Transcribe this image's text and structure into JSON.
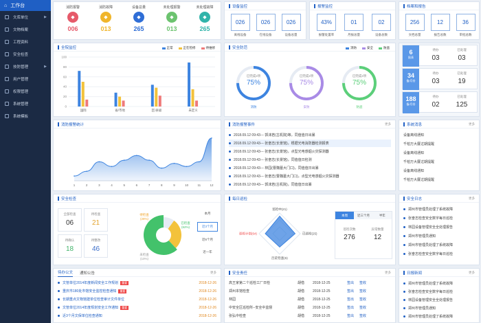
{
  "sidebar": {
    "head": "工作台",
    "items": [
      {
        "label": "文库单位",
        "arrow": true
      },
      {
        "label": "文物档案",
        "arrow": false
      },
      {
        "label": "工程资料",
        "arrow": false
      },
      {
        "label": "安全检查",
        "arrow": false
      },
      {
        "label": "技防管理",
        "arrow": true
      },
      {
        "label": "用户管理",
        "arrow": false
      },
      {
        "label": "权限管理",
        "arrow": false
      },
      {
        "label": "系统管理",
        "arrow": false
      },
      {
        "label": "系统模板",
        "arrow": false
      }
    ]
  },
  "stats": [
    {
      "label": "消防报警",
      "value": "006",
      "color": "#e65a6a"
    },
    {
      "label": "消防故障",
      "value": "013",
      "color": "#f0b52b"
    },
    {
      "label": "设备总量",
      "value": "265",
      "color": "#2f6ed6"
    },
    {
      "label": "未处理报警",
      "value": "013",
      "color": "#6cc36f"
    },
    {
      "label": "未处理故障",
      "value": "265",
      "color": "#31b4aa"
    }
  ],
  "devices": {
    "title": "设备监控",
    "items": [
      {
        "v": "026",
        "l": "离线设备"
      },
      {
        "v": "026",
        "l": "在线设备"
      },
      {
        "v": "026",
        "l": "设备总量"
      }
    ]
  },
  "alarms": {
    "title": "报警监控",
    "items": [
      {
        "v": "43%",
        "l": "报警处置率"
      },
      {
        "v": "01",
        "l": "月报总量"
      },
      {
        "v": "02",
        "l": "设备总数"
      }
    ]
  },
  "archive": {
    "title": "档案和报告",
    "items": [
      {
        "v": "256",
        "l": "文档总量"
      },
      {
        "v": "12",
        "l": "报告总数"
      },
      {
        "v": "36",
        "l": "审批总数"
      }
    ]
  },
  "bar": {
    "title": "全院监控",
    "legend": [
      "正常",
      "正在检修",
      "待维修"
    ],
    "colors": [
      "#3d84e0",
      "#f3c23b",
      "#ef7a7a"
    ]
  },
  "chart_data": [
    {
      "type": "bar",
      "title": "全院监控",
      "categories": [
        "国际",
        "省/市地",
        "区/县级",
        "未定义"
      ],
      "series": [
        {
          "name": "正常",
          "values": [
            72,
            28,
            44,
            89
          ]
        },
        {
          "name": "正在检修",
          "values": [
            50,
            20,
            38,
            35
          ]
        },
        {
          "name": "待维修",
          "values": [
            14,
            12,
            22,
            12
          ]
        }
      ],
      "ylim": [
        0,
        100
      ],
      "yticks": [
        0,
        20,
        40,
        60,
        80,
        100
      ]
    },
    {
      "type": "area",
      "title": "消防报警统计",
      "x": [
        1,
        2,
        3,
        4,
        5,
        6,
        7,
        8,
        9,
        10,
        11,
        12
      ],
      "series": [
        {
          "name": "",
          "values": [
            3,
            6,
            12,
            9,
            13,
            16,
            13,
            8,
            11,
            9,
            12,
            27
          ]
        }
      ],
      "ylim": [
        0,
        30
      ],
      "yticks": [
        0,
        10,
        20,
        30
      ]
    },
    {
      "type": "pie",
      "title": "安全检查",
      "labels": [
        "未检查",
        "待整改",
        "已检查"
      ],
      "values": [
        10,
        28,
        62
      ]
    }
  ],
  "safety": {
    "title": "安全防范",
    "legend": [
      "消防",
      "安全",
      "防盗"
    ],
    "rings": [
      {
        "label": "已完成2项",
        "pct": "75%",
        "sub": "消防",
        "color": "#3d84e0"
      },
      {
        "label": "已完成2项",
        "pct": "75%",
        "sub": "安防",
        "color": "#a98be6"
      },
      {
        "label": "已完成2项",
        "pct": "75%",
        "sub": "防盗",
        "color": "#5ccf7a"
      }
    ]
  },
  "events": {
    "title": "消防报警事件",
    "more": "更多",
    "items": [
      "2018.09.12  09:43---  郭沫若(古机院)等，同值值日出暴",
      "2018.09.12  09:43---  张奋志(长景馆)，根据光电消防器检测报表",
      "2018.09.12  09:43---  张奋志(长景馆)，点型光电感烟火灾探测器",
      "2018.09.12  09:43---  张奋志(长景馆)，同值值日检测",
      "2018.09.12  09:43---  林园(曹魏墓大门口)，同值值日出暴",
      "2018.09.12  09:43---  张奋志(曹魏墓大门口)，点型光电感烟火灾探测器",
      "2018.09.12  09:43---  郭沫若(古机院)，同值值日出暴"
    ]
  },
  "stat2": {
    "cards": [
      {
        "big": "6",
        "small": "报表",
        "a": "待办",
        "av": "03",
        "b": "已处理",
        "bv": "03"
      },
      {
        "big": "34",
        "small": "备/月份",
        "a": "待办",
        "av": "03",
        "b": "已处理",
        "bv": "19"
      },
      {
        "big": "188",
        "small": "备/月份",
        "a": "待办",
        "av": "02",
        "b": "已处理",
        "bv": "125"
      }
    ]
  },
  "notices": {
    "title": "系统消息",
    "more": "更多",
    "items": [
      "设备离线通知",
      "千柏万大厦过期提醒",
      "设备离线通知",
      "千柏万大厦过期提醒",
      "设备离线通知",
      "千柏万大厦过期提醒"
    ]
  },
  "check": {
    "title": "安全检查",
    "boxes": [
      {
        "l": "全部检查",
        "v": "06",
        "c": "#333"
      },
      {
        "l": "待检查",
        "v": "21",
        "c": "#e3a32b"
      },
      {
        "l": "待确认",
        "v": "18",
        "c": "#43b46b"
      },
      {
        "l": "待整改",
        "v": "46",
        "c": "#3d6fc9"
      }
    ],
    "tabs": [
      "本月",
      "近3个月",
      "近6个月",
      "近一年"
    ],
    "pie": [
      {
        "l": "待检查",
        "sub": "(28%)"
      },
      {
        "l": "已检查",
        "sub": "(62%)"
      },
      {
        "l": "未检查",
        "sub": "(10%)"
      }
    ]
  },
  "radar": {
    "title": "每日巡检",
    "labels": [
      "巡检中(21)",
      "已巡检(25)",
      "历史检查(6)",
      "巡检计划(64)"
    ],
    "tabs": [
      "本周",
      "近三个月",
      "半年"
    ],
    "lv": "276",
    "ll": "巡检次数",
    "rv": "12",
    "rl": "异常数量"
  },
  "log": {
    "title": "安全日志",
    "more": "更多",
    "items": [
      "郑州市管理员处理了系统故障",
      "张奋志检查安全数字每日巡检",
      "林园设备管理安全全处理报告",
      "郑州市管理员通知",
      "郑州市管理员处理了系统故障",
      "张奋志检查安全数字每日巡检"
    ]
  },
  "docs": {
    "tabs": [
      "待办公文",
      "通知公告"
    ],
    "more": "更多",
    "items": [
      {
        "t": "文管单位2014年度新闻安全工作规划",
        "tag": "重要",
        "d": "2018-12-26"
      },
      {
        "t": "重庆市180处市馆安全监控检查通知",
        "tag": "重要",
        "d": "2018-12-26"
      },
      {
        "t": "长期重点文物馆建单位检查审计文件单位",
        "tag": "",
        "d": "2018-12-26"
      },
      {
        "t": "文管单位2014年度规划安全工作通知",
        "tag": "重要",
        "d": "2018-12-26"
      },
      {
        "t": "近3个月文保单位检查通知",
        "tag": "",
        "d": "2018-12-26"
      }
    ]
  },
  "tasks": {
    "title": "安全责任",
    "more": "更多",
    "items": [
      {
        "n": "高王家第二个巡检工厂日检",
        "p": "胡借",
        "d": "2018-12-25",
        "a": "签出",
        "b": "签收"
      },
      {
        "n": "郑州本馆检查",
        "p": "胡借",
        "d": "2018-12-25",
        "a": "签出",
        "b": "签收"
      },
      {
        "n": "林园",
        "p": "胡借",
        "d": "2018-12-25",
        "a": "签出",
        "b": "签收"
      },
      {
        "n": "中安全区巡检所--安全中监督",
        "p": "胡借",
        "d": "2018-12-25",
        "a": "签出",
        "b": "签收"
      },
      {
        "n": "张弘中检查",
        "p": "胡借",
        "d": "2018-12-25",
        "a": "签出",
        "b": "签收"
      }
    ]
  },
  "report": {
    "title": "日报新闻",
    "more": "更多",
    "items": [
      "郑州市管理员处理了系统故障",
      "张奋志检查安全数字每日巡检",
      "林园设备管理安全全处理报告",
      "郑州市管理员通知",
      "郑州市管理员处理了系统故障"
    ]
  }
}
